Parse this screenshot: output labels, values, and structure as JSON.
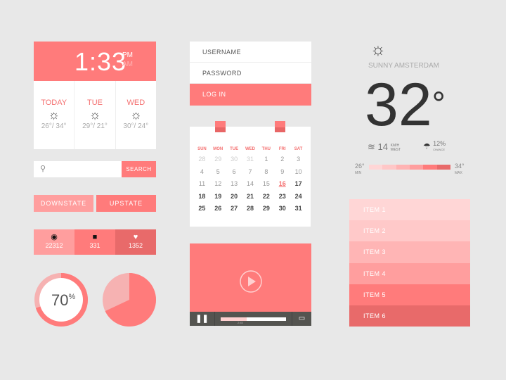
{
  "clock": {
    "time": "1:33",
    "pm": "PM",
    "am": "AM",
    "days": [
      {
        "name": "TODAY",
        "temps": "26°/ 34°",
        "icon": "sun-icon"
      },
      {
        "name": "TUE",
        "temps": "29°/ 21°",
        "icon": "sun-icon"
      },
      {
        "name": "WED",
        "temps": "30°/ 24°",
        "icon": "sun-icon"
      }
    ]
  },
  "search": {
    "placeholder": "",
    "button": "SEARCH"
  },
  "buttons": {
    "downstate": "DOWNSTATE",
    "upstate": "UPSTATE"
  },
  "stats": [
    {
      "icon": "eye-icon",
      "value": "22312",
      "color": "#ff9e9e"
    },
    {
      "icon": "comment-icon",
      "value": "331",
      "color": "#ff7b7b"
    },
    {
      "icon": "heart-icon",
      "value": "1352",
      "color": "#e86a6a"
    }
  ],
  "donut": {
    "percent": 70,
    "label": "70",
    "unit": "%"
  },
  "pie": {
    "percent": 68
  },
  "login": {
    "username": "USERNAME",
    "password": "PASSWORD",
    "button": "LOG IN"
  },
  "calendar": {
    "weekdays": [
      "SUN",
      "MON",
      "TUE",
      "WED",
      "THU",
      "FRI",
      "SAT"
    ],
    "days": [
      [
        "28",
        0
      ],
      [
        "29",
        0
      ],
      [
        "30",
        0
      ],
      [
        "31",
        0
      ],
      [
        "1",
        1
      ],
      [
        "2",
        1
      ],
      [
        "3",
        1
      ],
      [
        "4",
        1
      ],
      [
        "5",
        1
      ],
      [
        "6",
        1
      ],
      [
        "7",
        1
      ],
      [
        "8",
        1
      ],
      [
        "9",
        1
      ],
      [
        "10",
        1
      ],
      [
        "11",
        1
      ],
      [
        "12",
        1
      ],
      [
        "13",
        1
      ],
      [
        "14",
        1
      ],
      [
        "15",
        1
      ],
      [
        "16",
        3
      ],
      [
        "17",
        2
      ],
      [
        "18",
        2
      ],
      [
        "19",
        2
      ],
      [
        "20",
        2
      ],
      [
        "21",
        2
      ],
      [
        "22",
        2
      ],
      [
        "23",
        2
      ],
      [
        "24",
        2
      ],
      [
        "25",
        2
      ],
      [
        "26",
        2
      ],
      [
        "27",
        2
      ],
      [
        "28",
        2
      ],
      [
        "29",
        2
      ],
      [
        "30",
        2
      ],
      [
        "31",
        2
      ]
    ]
  },
  "video": {
    "time": "2:45",
    "progress": 0.4,
    "icons": [
      "play-icon",
      "pause-icon",
      "airplay-icon"
    ]
  },
  "weather": {
    "condition": "SUNNY AMSTERDAM",
    "temp": "32",
    "deg": "°",
    "wind": "14",
    "wind_unit": "KM/H",
    "wind_dir": "WEST",
    "rain": "12%",
    "rain_label": "CHANCE",
    "min": "26°",
    "min_label": "MIN",
    "max": "34°",
    "max_label": "MAX",
    "scale_colors": [
      "#ffd6d6",
      "#ffc7c7",
      "#ffb3b3",
      "#ff9e9e",
      "#ff7b7b",
      "#e86a6a"
    ]
  },
  "list": [
    {
      "label": "ITEM 1",
      "color": "#ffd6d6"
    },
    {
      "label": "ITEM 2",
      "color": "#ffc9c9"
    },
    {
      "label": "ITEM 3",
      "color": "#ffb5b5"
    },
    {
      "label": "ITEM 4",
      "color": "#ff9e9e"
    },
    {
      "label": "ITEM 5",
      "color": "#ff7b7b"
    },
    {
      "label": "ITEM 6",
      "color": "#e86a6a"
    }
  ]
}
